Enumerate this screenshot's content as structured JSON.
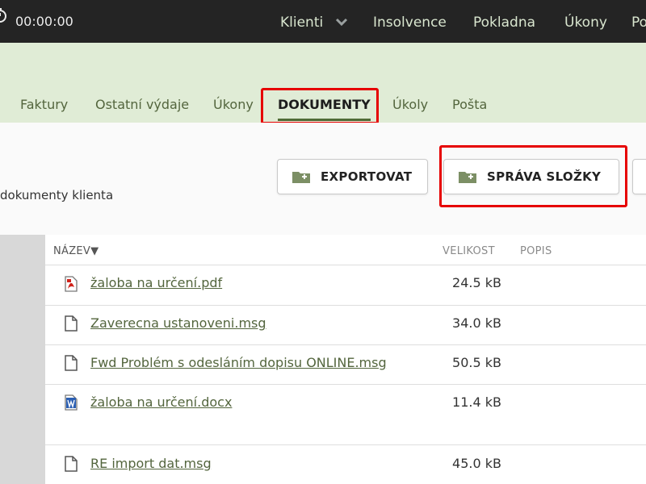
{
  "topbar": {
    "timer": "00:00:00",
    "nav": [
      "Klienti",
      "Insolvence",
      "Pokladna",
      "Úkony",
      "Po"
    ]
  },
  "tabs": [
    "Faktury",
    "Ostatní výdaje",
    "Úkony",
    "DOKUMENTY",
    "Úkoly",
    "Pošta"
  ],
  "active_tab": "DOKUMENTY",
  "toolbar": {
    "subtitle": "dokumenty klienta",
    "export_label": "EXPORTOVAT",
    "manage_label": "SPRÁVA SLOŽKY"
  },
  "table": {
    "headers": {
      "name": "NÁZEV",
      "sort_marker": "▼",
      "size": "VELIKOST",
      "desc": "POPIS"
    },
    "rows": [
      {
        "name": "žaloba na určení.pdf",
        "size": "24.5 kB",
        "icon": "pdf-icon"
      },
      {
        "name": "Zaverecna ustanoveni.msg",
        "size": "34.0 kB",
        "icon": "file-icon"
      },
      {
        "name": "Fwd Problém s odesláním dopisu ONLINE.msg",
        "size": "50.5 kB",
        "icon": "file-icon"
      },
      {
        "name": "žaloba na určení.docx",
        "size": "11.4 kB",
        "icon": "word-icon"
      },
      {
        "name": "RE import dat.msg",
        "size": "45.0 kB",
        "icon": "file-icon"
      }
    ]
  },
  "colors": {
    "topbar": "#242424",
    "band": "#e0ecd6",
    "link_green": "#53653d",
    "highlight_red": "#e60000"
  }
}
